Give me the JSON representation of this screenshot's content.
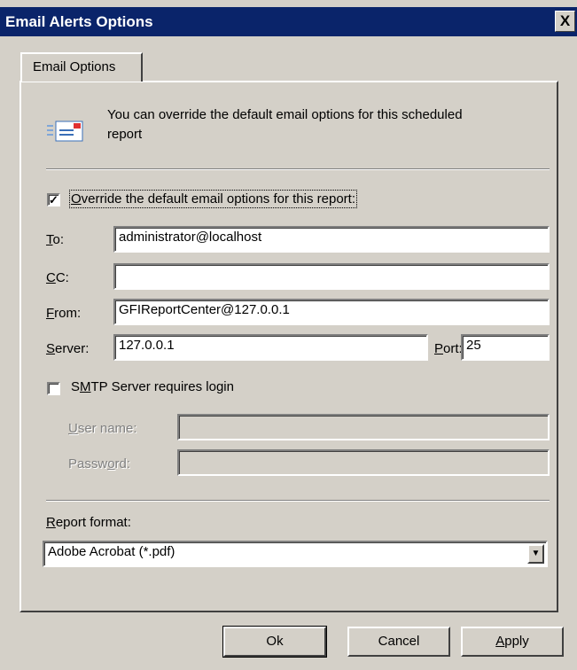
{
  "window": {
    "title": "Email Alerts Options",
    "close_glyph": "X"
  },
  "tab": {
    "label": "Email Options"
  },
  "intro": {
    "icon": "email-message-icon",
    "text_line1": "You can override the default email options for this scheduled",
    "text_line2": "report"
  },
  "override": {
    "checked": true,
    "check_glyph": "✓",
    "label_accel": "O",
    "label_rest": "verride the default email options for this report:"
  },
  "fields": {
    "to": {
      "accel": "T",
      "rest": "o:",
      "value": "administrator@localhost"
    },
    "cc": {
      "accel": "C",
      "rest": "C:",
      "value": ""
    },
    "from": {
      "accel": "F",
      "rest": "rom:",
      "value": "GFIReportCenter@127.0.0.1"
    },
    "server": {
      "accel": "S",
      "rest": "erver:",
      "value": "127.0.0.1"
    },
    "port": {
      "accel": "P",
      "rest": "ort:",
      "value": "25"
    }
  },
  "smtp": {
    "checked": false,
    "pre": "S",
    "accel": "M",
    "rest": "TP Server requires login"
  },
  "login": {
    "username": {
      "accel": "U",
      "rest": "ser name:",
      "value": ""
    },
    "password": {
      "pre": "Passw",
      "accel": "o",
      "rest": "rd:",
      "value": ""
    }
  },
  "report_format": {
    "accel": "R",
    "rest": "eport format:",
    "selected": "Adobe Acrobat (*.pdf)",
    "arrow_glyph": "▼"
  },
  "buttons": {
    "ok": {
      "label": "Ok"
    },
    "cancel": {
      "label": "Cancel"
    },
    "apply_accel": "A",
    "apply_rest": "pply"
  }
}
